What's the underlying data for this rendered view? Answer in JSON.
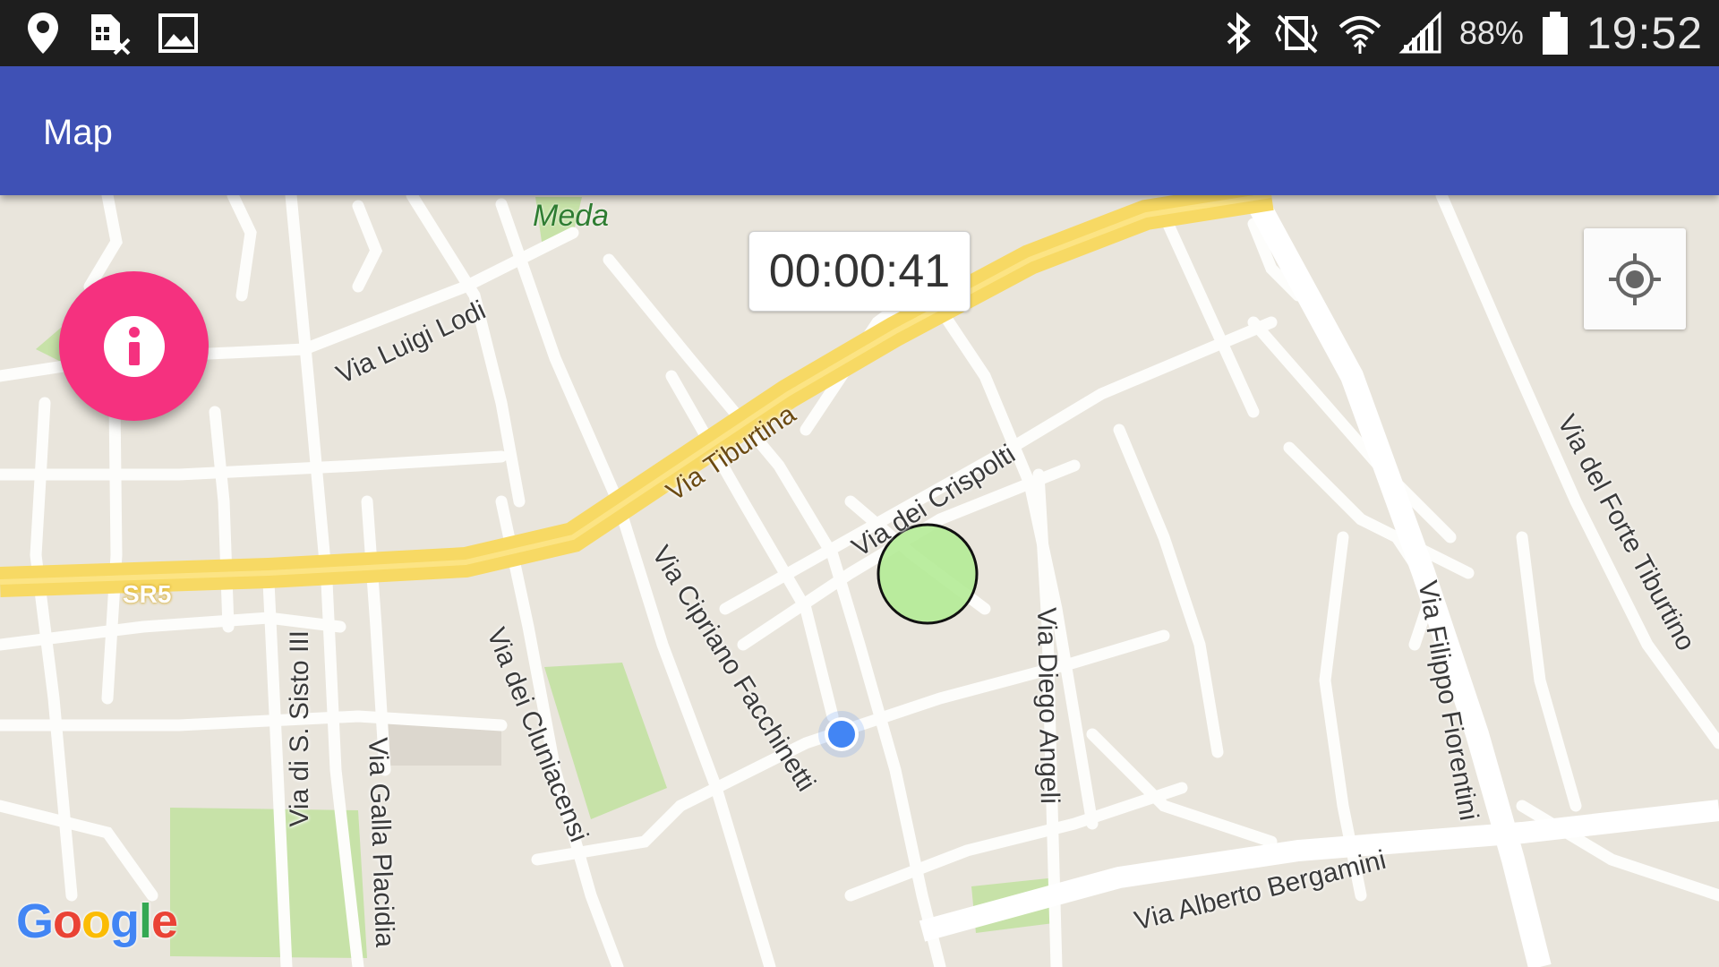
{
  "status_bar": {
    "left_icons": [
      "location-pin-icon",
      "sim-card-off-icon",
      "image-icon"
    ],
    "right_icons": [
      "bluetooth-icon",
      "vibrate-mute-icon",
      "wifi-icon",
      "cellular-signal-icon",
      "battery-icon"
    ],
    "battery_percent": "88%",
    "time": "19:52"
  },
  "app_bar": {
    "title": "Map",
    "color": "#3f51b5"
  },
  "map": {
    "timer": "00:00:41",
    "streets": {
      "via_luigi_lodi": "Via Luigi Lodi",
      "via_tiburtina": "Via Tiburtina",
      "sr5": "SR5",
      "via_dei_crispolti": "Via dei Crispolti",
      "via_cipriano_facchinetti": "Via Cipriano Facchinetti",
      "via_dei_cluniacensi": "Via dei Cluniacensi",
      "via_di_s_sisto_iii": "Via di S. Sisto III",
      "via_galla_placidia": "Via Galla Placidia",
      "via_diego_angeli": "Via Diego Angeli",
      "via_filippo_fiorentini": "Via Filippo Fiorentini",
      "via_del_forte_tiburtino": "Via del Forte Tiburtino",
      "via_alberto_bergamini": "Via Alberto Bergamini"
    },
    "poi": "Meda",
    "google_logo": "Google",
    "fab_icon": "info-icon",
    "fab_color": "#f5317f",
    "locate_icon": "my-location-icon",
    "geofence_color": "#b4eb96",
    "user_location_color": "#4285f4"
  }
}
